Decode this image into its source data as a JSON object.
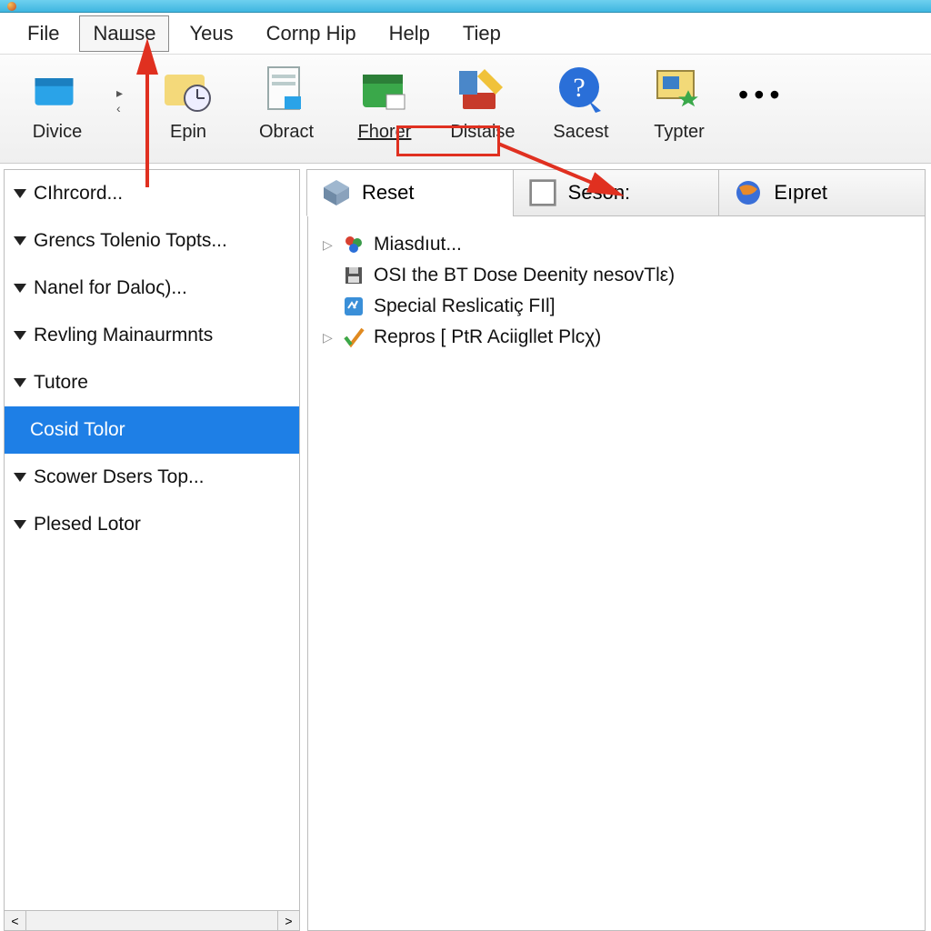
{
  "titlebar": {
    "title": ""
  },
  "menubar": {
    "items": [
      {
        "label": "File"
      },
      {
        "label": "Naшse",
        "boxed": true
      },
      {
        "label": "Yeus"
      },
      {
        "label": "Cornp Hip"
      },
      {
        "label": "Help"
      },
      {
        "label": "Tiep"
      }
    ]
  },
  "toolbar": {
    "items": [
      {
        "label": "Divice",
        "icon": "folder"
      },
      {
        "label": "Epin",
        "icon": "clock-folder"
      },
      {
        "label": "Obract",
        "icon": "doc"
      },
      {
        "label": "Fhorer",
        "icon": "green-box",
        "underline": true
      },
      {
        "label": "Distaise",
        "icon": "tools",
        "highlight": true
      },
      {
        "label": "Sacest",
        "icon": "help"
      },
      {
        "label": "Typter",
        "icon": "window-star"
      }
    ],
    "overflow": "•••"
  },
  "sidebar": {
    "items": [
      {
        "label": "CIhrcord..."
      },
      {
        "label": "Grencs Tolenio Topts..."
      },
      {
        "label": "Nanel for Daloς)..."
      },
      {
        "label": "Revling Mainaurmnts"
      },
      {
        "label": "Tutore"
      },
      {
        "label": "Cosid Tolor",
        "selected": true
      },
      {
        "label": "Scower Dsers Top..."
      },
      {
        "label": "Plesed Lotor"
      }
    ]
  },
  "tabs": [
    {
      "label": "Reset",
      "icon": "cube",
      "active": true
    },
    {
      "label": "Seson:",
      "icon": "checkbox"
    },
    {
      "label": "Eıpret",
      "icon": "globe"
    }
  ],
  "tree": [
    {
      "expandable": true,
      "icon": "orbs",
      "label": "Miasdıut..."
    },
    {
      "expandable": false,
      "icon": "floppy",
      "label": "OSI the BT Dose Deenity nesovTlε)"
    },
    {
      "expandable": false,
      "icon": "blue-sq",
      "label": "Special Reslicatiç FIl]"
    },
    {
      "expandable": true,
      "icon": "check",
      "label": "Repros [ PtR Aciigllet Plcχ)"
    }
  ],
  "colors": {
    "accent": "#1e7fe6",
    "annotation": "#e03020"
  }
}
